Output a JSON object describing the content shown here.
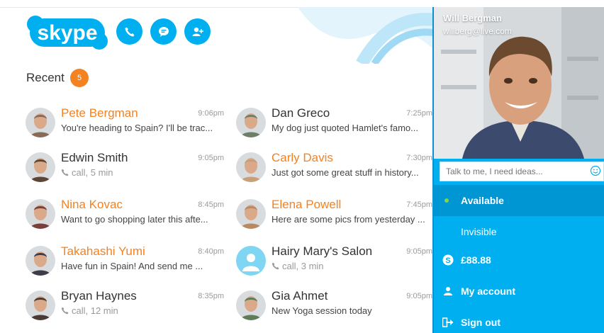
{
  "app": {
    "logo_text": "skype"
  },
  "header": {
    "buttons": [
      {
        "name": "call-button",
        "icon": "phone-icon"
      },
      {
        "name": "chat-button",
        "icon": "chat-bubble-icon"
      },
      {
        "name": "add-contact-button",
        "icon": "add-contact-icon"
      }
    ]
  },
  "recent": {
    "title": "Recent",
    "badge": "5"
  },
  "contacts": [
    {
      "name": "Pete Bergman",
      "time": "9:06pm",
      "message": "You're heading to Spain? I'll be trac...",
      "unread": true,
      "type": "message"
    },
    {
      "name": "Dan Greco",
      "time": "7:25pm",
      "message": "My dog just quoted Hamlet's famo...",
      "unread": false,
      "type": "message"
    },
    {
      "name": "Edwin Smith",
      "time": "9:05pm",
      "message": "call, 5 min",
      "unread": false,
      "type": "call"
    },
    {
      "name": "Carly Davis",
      "time": "7:30pm",
      "message": "Just got some great stuff in history...",
      "unread": true,
      "type": "message"
    },
    {
      "name": "Nina Kovac",
      "time": "8:45pm",
      "message": "Want to go shopping later this afte...",
      "unread": true,
      "type": "message"
    },
    {
      "name": "Elena Powell",
      "time": "7:45pm",
      "message": "Here are some pics from yesterday ...",
      "unread": true,
      "type": "message"
    },
    {
      "name": "Takahashi Yumi",
      "time": "8:40pm",
      "message": "Have fun in Spain! And send me ...",
      "unread": true,
      "type": "message"
    },
    {
      "name": "Hairy Mary's Salon",
      "time": "9:05pm",
      "message": "call, 3 min",
      "unread": false,
      "type": "call"
    },
    {
      "name": "Bryan Haynes",
      "time": "8:35pm",
      "message": "call, 12 min",
      "unread": false,
      "type": "call"
    },
    {
      "name": "Gia Ahmet",
      "time": "9:05pm",
      "message": "New Yoga session today",
      "unread": false,
      "type": "message"
    }
  ],
  "profile": {
    "name": "Will Bergman",
    "email": "willberg@live.com",
    "mood_placeholder": "Talk to me, I need ideas..."
  },
  "menu": {
    "available": "Available",
    "invisible": "Invisible",
    "credit": "£88.88",
    "my_account": "My account",
    "sign_out": "Sign out"
  },
  "colors": {
    "brand_blue": "#00aff0",
    "active_blue": "#0096d4",
    "unread_orange": "#f58220",
    "available_green": "#7bd84a"
  }
}
